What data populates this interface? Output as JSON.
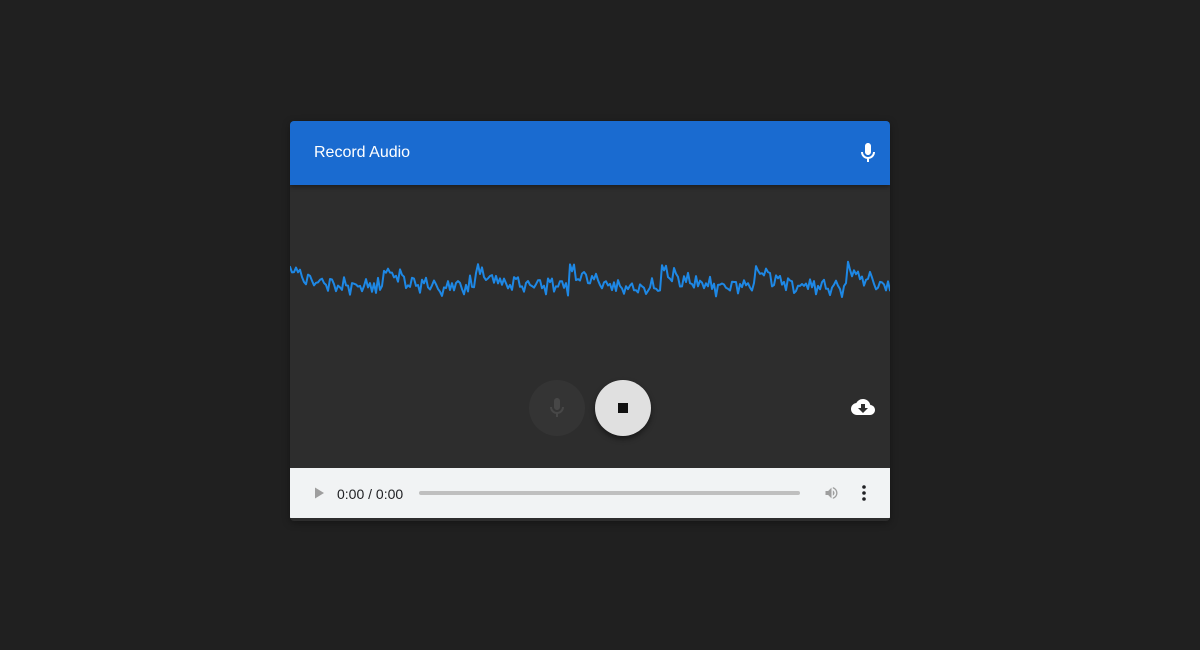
{
  "app": {
    "title": "Record Audio"
  },
  "colors": {
    "page_background": "#202020",
    "card_background": "#2d2d2d",
    "header_background": "#1a6bd0",
    "waveform": "#1e88e5",
    "stop_button": "#e0e0e0",
    "player_background": "#f1f3f4"
  },
  "icons": {
    "header": "microphone-icon",
    "record": "microphone-icon",
    "stop": "stop-icon",
    "download": "cloud-download-icon",
    "play": "play-icon",
    "volume": "volume-icon",
    "more": "more-vert-icon"
  },
  "player": {
    "time": "0:00 / 0:00",
    "progress": 0
  }
}
